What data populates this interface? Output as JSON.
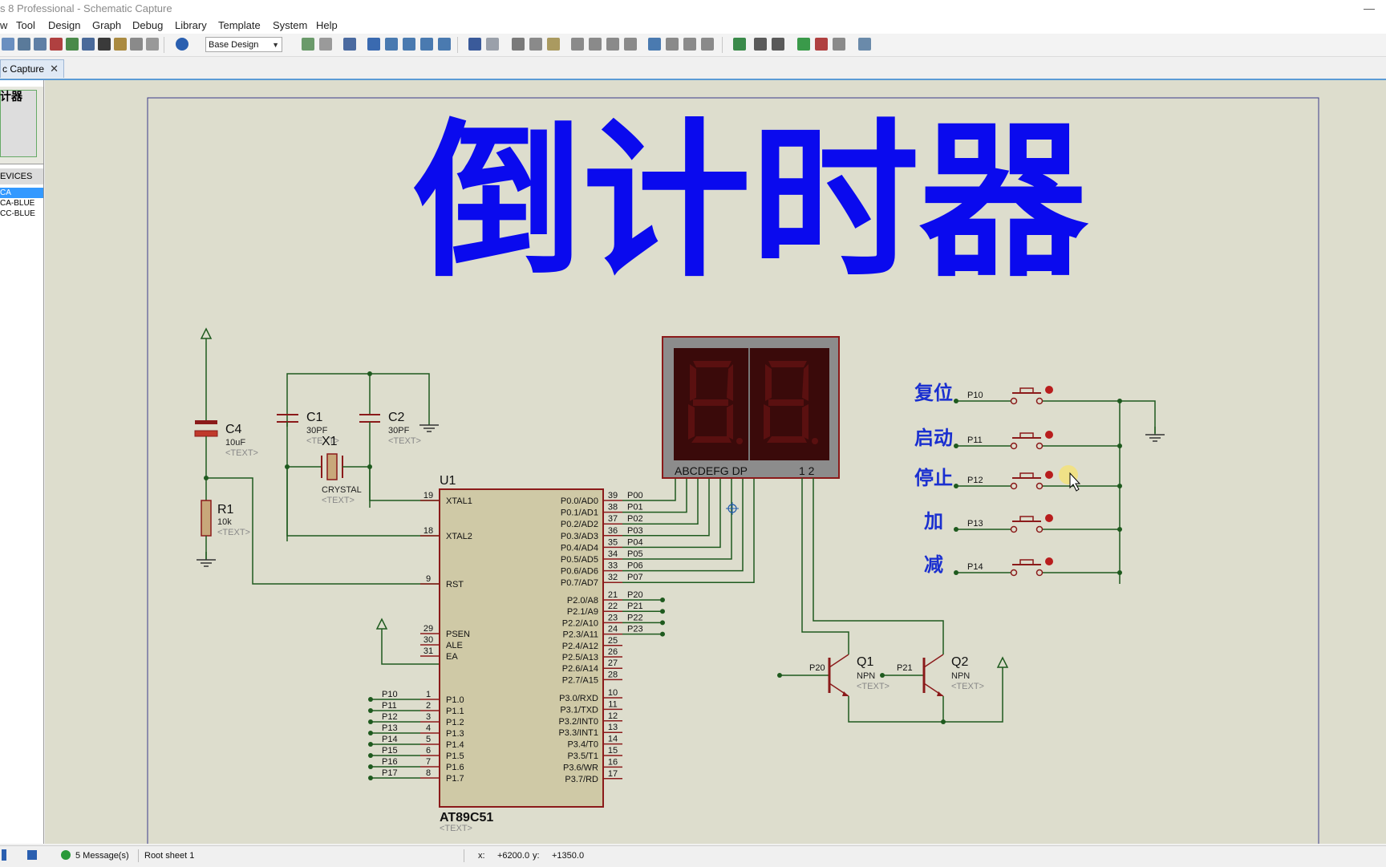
{
  "window": {
    "title": "s 8 Professional - Schematic Capture"
  },
  "menu": [
    "w",
    "Tool",
    "Design",
    "Graph",
    "Debug",
    "Library",
    "Template",
    "System",
    "Help"
  ],
  "toolbar": {
    "design_select": "Base Design"
  },
  "tab": {
    "label": "c Capture"
  },
  "left_panel": {
    "preview_label": "计器",
    "devices_header": "EVICES",
    "devices": [
      "CA",
      "CA-BLUE",
      "CC-BLUE"
    ]
  },
  "schematic": {
    "title": "倒计时器",
    "buttons": [
      {
        "label": "复位",
        "net": "P10"
      },
      {
        "label": "启动",
        "net": "P11"
      },
      {
        "label": "停止",
        "net": "P12"
      },
      {
        "label": "加",
        "net": "P13"
      },
      {
        "label": "减",
        "net": "P14"
      }
    ],
    "c4": {
      "name": "C4",
      "value": "10uF",
      "text": "<TEXT>"
    },
    "r1": {
      "name": "R1",
      "value": "10k",
      "text": "<TEXT>"
    },
    "c1": {
      "name": "C1",
      "value": "30PF",
      "text": "<TEXT>"
    },
    "c2": {
      "name": "C2",
      "value": "30PF",
      "text": "<TEXT>"
    },
    "x1": {
      "name": "X1",
      "value": "CRYSTAL",
      "text": "<TEXT>"
    },
    "u1": {
      "name": "U1",
      "part": "AT89C51",
      "text": "<TEXT>"
    },
    "display": {
      "segments_label": "ABCDEFG  DP",
      "digits_label": "1 2"
    },
    "q1": {
      "name": "Q1",
      "type": "NPN",
      "text": "<TEXT>",
      "net": "P20"
    },
    "q2": {
      "name": "Q2",
      "type": "NPN",
      "text": "<TEXT>",
      "net": "P21"
    },
    "mcu_left_pins": [
      {
        "pin": "19",
        "name": "XTAL1"
      },
      {
        "pin": "18",
        "name": "XTAL2"
      },
      {
        "pin": "9",
        "name": "RST"
      },
      {
        "pin": "29",
        "name": "PSEN"
      },
      {
        "pin": "30",
        "name": "ALE"
      },
      {
        "pin": "31",
        "name": "EA"
      },
      {
        "pin": "1",
        "name": "P1.0",
        "net": "P10"
      },
      {
        "pin": "2",
        "name": "P1.1",
        "net": "P11"
      },
      {
        "pin": "3",
        "name": "P1.2",
        "net": "P12"
      },
      {
        "pin": "4",
        "name": "P1.3",
        "net": "P13"
      },
      {
        "pin": "5",
        "name": "P1.4",
        "net": "P14"
      },
      {
        "pin": "6",
        "name": "P1.5",
        "net": "P15"
      },
      {
        "pin": "7",
        "name": "P1.6",
        "net": "P16"
      },
      {
        "pin": "8",
        "name": "P1.7",
        "net": "P17"
      }
    ],
    "mcu_right_pins": [
      {
        "pin": "39",
        "name": "P0.0/AD0",
        "net": "P00"
      },
      {
        "pin": "38",
        "name": "P0.1/AD1",
        "net": "P01"
      },
      {
        "pin": "37",
        "name": "P0.2/AD2",
        "net": "P02"
      },
      {
        "pin": "36",
        "name": "P0.3/AD3",
        "net": "P03"
      },
      {
        "pin": "35",
        "name": "P0.4/AD4",
        "net": "P04"
      },
      {
        "pin": "34",
        "name": "P0.5/AD5",
        "net": "P05"
      },
      {
        "pin": "33",
        "name": "P0.6/AD6",
        "net": "P06"
      },
      {
        "pin": "32",
        "name": "P0.7/AD7",
        "net": "P07"
      },
      {
        "pin": "21",
        "name": "P2.0/A8",
        "net": "P20"
      },
      {
        "pin": "22",
        "name": "P2.1/A9",
        "net": "P21"
      },
      {
        "pin": "23",
        "name": "P2.2/A10",
        "net": "P22"
      },
      {
        "pin": "24",
        "name": "P2.3/A11",
        "net": "P23"
      },
      {
        "pin": "25",
        "name": "P2.4/A12",
        "net": ""
      },
      {
        "pin": "26",
        "name": "P2.5/A13",
        "net": ""
      },
      {
        "pin": "27",
        "name": "P2.6/A14",
        "net": ""
      },
      {
        "pin": "28",
        "name": "P2.7/A15",
        "net": ""
      },
      {
        "pin": "10",
        "name": "P3.0/RXD",
        "net": ""
      },
      {
        "pin": "11",
        "name": "P3.1/TXD",
        "net": ""
      },
      {
        "pin": "12",
        "name": "P3.2/INT0",
        "net": ""
      },
      {
        "pin": "13",
        "name": "P3.3/INT1",
        "net": ""
      },
      {
        "pin": "14",
        "name": "P3.4/T0",
        "net": ""
      },
      {
        "pin": "15",
        "name": "P3.5/T1",
        "net": ""
      },
      {
        "pin": "16",
        "name": "P3.6/WR",
        "net": ""
      },
      {
        "pin": "17",
        "name": "P3.7/RD",
        "net": ""
      }
    ]
  },
  "status": {
    "messages": "5 Message(s)",
    "sheet": "Root sheet 1",
    "x_label": "x:",
    "x_value": "+6200.0",
    "y_label": "y:",
    "y_value": "+1350.0"
  },
  "colors": {
    "title_blue": "#0a0aee",
    "wire": "#1e5a1e",
    "component": "#8b1a1a",
    "chip_fill": "#cfc9a6",
    "canvas_bg": "#ddddcd"
  }
}
